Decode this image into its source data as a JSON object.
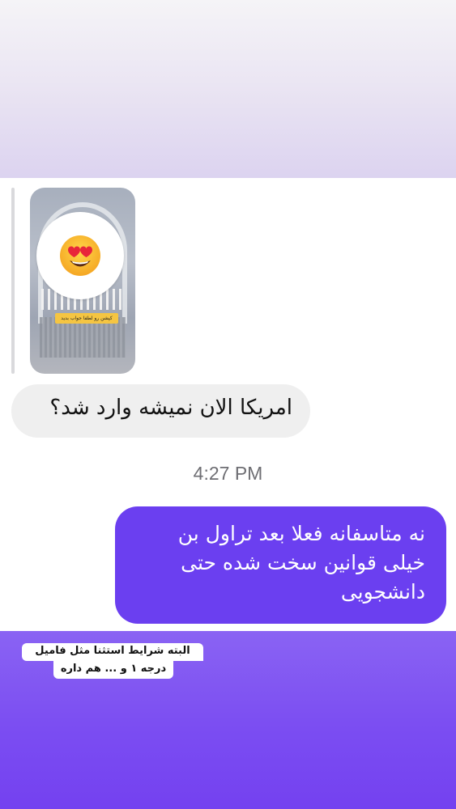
{
  "story_reply": {
    "sticker_icon": "heart-eyes-emoji",
    "caption": "کپشن رو لطفا جواب بدید"
  },
  "messages": [
    {
      "direction": "incoming",
      "text": "امریکا الان نمیشه وارد شد؟"
    },
    {
      "direction": "outgoing",
      "text": "نه متاسفانه فعلا بعد تراول بن خیلی قوانین سخت  شده حتی دانشجویی"
    }
  ],
  "timestamp": "4:27 PM",
  "overlay_note": {
    "line1": "البته شرایط استثنا مثل فامیل",
    "line2": "درجه ۱ و ... هم داره"
  },
  "colors": {
    "outgoing_bubble": "#6b3ff0",
    "incoming_bubble": "#efefef",
    "bottom_gradient": "#7b4df2"
  }
}
